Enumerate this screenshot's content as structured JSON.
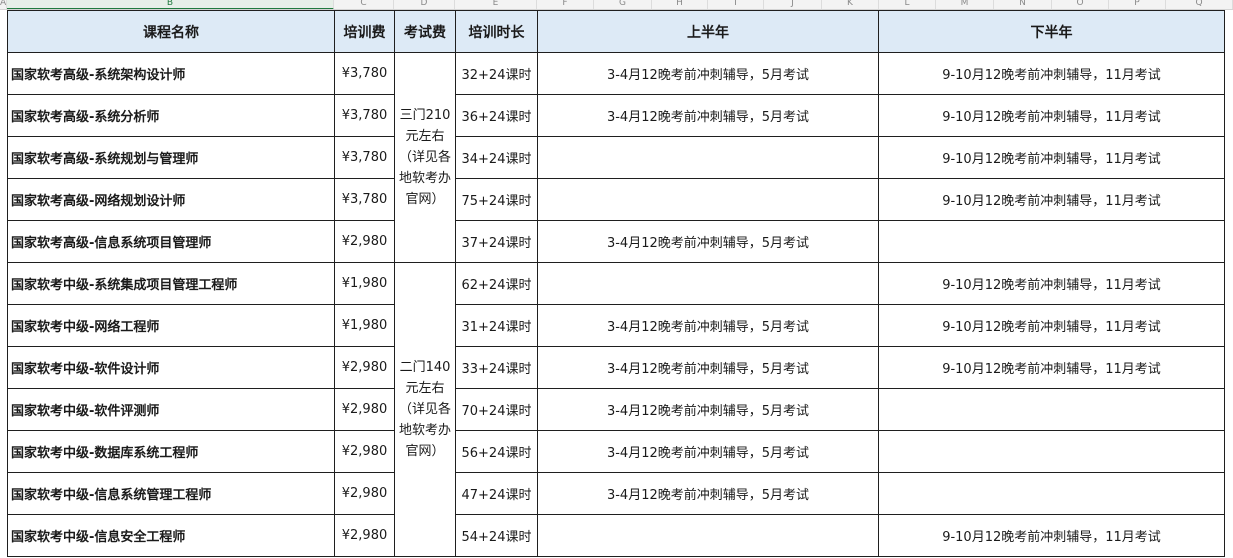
{
  "column_letters": [
    "A",
    "B",
    "C",
    "D",
    "E",
    "F",
    "G",
    "H",
    "I",
    "J",
    "K",
    "L",
    "M",
    "N",
    "O",
    "P",
    "Q"
  ],
  "headers": {
    "course": "课程名称",
    "training_fee": "培训费",
    "exam_fee": "考试费",
    "duration": "培训时长",
    "first_half": "上半年",
    "second_half": "下半年"
  },
  "exam_fee_groups": [
    "三门210元左右（详见各地软考办官网）",
    "二门140元左右（详见各地软考办官网）"
  ],
  "rows": [
    {
      "course": "国家软考高级-系统架构设计师",
      "fee": "¥3,780",
      "hours": "32+24课时",
      "h1": "3-4月12晚考前冲刺辅导，5月考试",
      "h2": "9-10月12晚考前冲刺辅导，11月考试"
    },
    {
      "course": "国家软考高级-系统分析师",
      "fee": "¥3,780",
      "hours": "36+24课时",
      "h1": "3-4月12晚考前冲刺辅导，5月考试",
      "h2": "9-10月12晚考前冲刺辅导，11月考试"
    },
    {
      "course": "国家软考高级-系统规划与管理师",
      "fee": "¥3,780",
      "hours": "34+24课时",
      "h1": "",
      "h2": "9-10月12晚考前冲刺辅导，11月考试"
    },
    {
      "course": "国家软考高级-网络规划设计师",
      "fee": "¥3,780",
      "hours": "75+24课时",
      "h1": "",
      "h2": "9-10月12晚考前冲刺辅导，11月考试"
    },
    {
      "course": "国家软考高级-信息系统项目管理师",
      "fee": "¥2,980",
      "hours": "37+24课时",
      "h1": "3-4月12晚考前冲刺辅导，5月考试",
      "h2": ""
    },
    {
      "course": "国家软考中级-系统集成项目管理工程师",
      "fee": "¥1,980",
      "hours": "62+24课时",
      "h1": "",
      "h2": "9-10月12晚考前冲刺辅导，11月考试"
    },
    {
      "course": "国家软考中级-网络工程师",
      "fee": "¥1,980",
      "hours": "31+24课时",
      "h1": "3-4月12晚考前冲刺辅导，5月考试",
      "h2": "9-10月12晚考前冲刺辅导，11月考试"
    },
    {
      "course": "国家软考中级-软件设计师",
      "fee": "¥2,980",
      "hours": "33+24课时",
      "h1": "3-4月12晚考前冲刺辅导，5月考试",
      "h2": "9-10月12晚考前冲刺辅导，11月考试"
    },
    {
      "course": "国家软考中级-软件评测师",
      "fee": "¥2,980",
      "hours": "70+24课时",
      "h1": "3-4月12晚考前冲刺辅导，5月考试",
      "h2": ""
    },
    {
      "course": "国家软考中级-数据库系统工程师",
      "fee": "¥2,980",
      "hours": "56+24课时",
      "h1": "3-4月12晚考前冲刺辅导，5月考试",
      "h2": ""
    },
    {
      "course": "国家软考中级-信息系统管理工程师",
      "fee": "¥2,980",
      "hours": "47+24课时",
      "h1": "3-4月12晚考前冲刺辅导，5月考试",
      "h2": ""
    },
    {
      "course": "国家软考中级-信息安全工程师",
      "fee": "¥2,980",
      "hours": "54+24课时",
      "h1": "",
      "h2": "9-10月12晚考前冲刺辅导，11月考试"
    }
  ]
}
